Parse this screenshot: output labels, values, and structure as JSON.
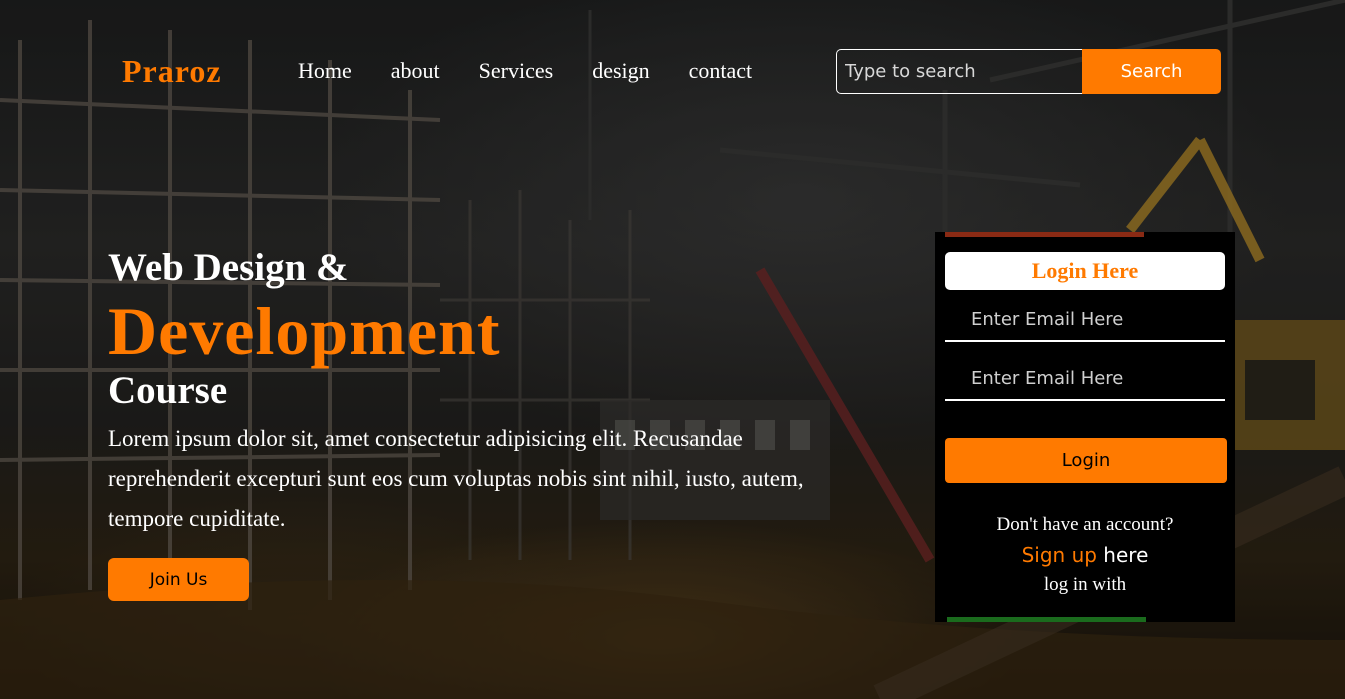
{
  "header": {
    "logo": "Praroz",
    "nav": [
      "Home",
      "about",
      "Services",
      "design",
      "contact"
    ],
    "search_placeholder": "Type to search",
    "search_button": "Search"
  },
  "hero": {
    "line1": "Web Design &",
    "line2": "Development",
    "line3": "Course",
    "description": "Lorem ipsum dolor sit, amet consectetur adipisicing elit. Recusandae reprehenderit excepturi sunt eos cum voluptas nobis sint nihil, iusto, autem, tempore cupiditate.",
    "join_button": "Join Us"
  },
  "login": {
    "title": "Login Here",
    "email_placeholder": "Enter Email Here",
    "password_placeholder": "Enter Email Here",
    "login_button": "Login",
    "no_account": "Don't have an account?",
    "signup_link": "Sign up",
    "signup_suffix": " here",
    "login_with": "log in with"
  },
  "colors": {
    "accent": "#ff7a00",
    "card_bg": "#000000"
  }
}
